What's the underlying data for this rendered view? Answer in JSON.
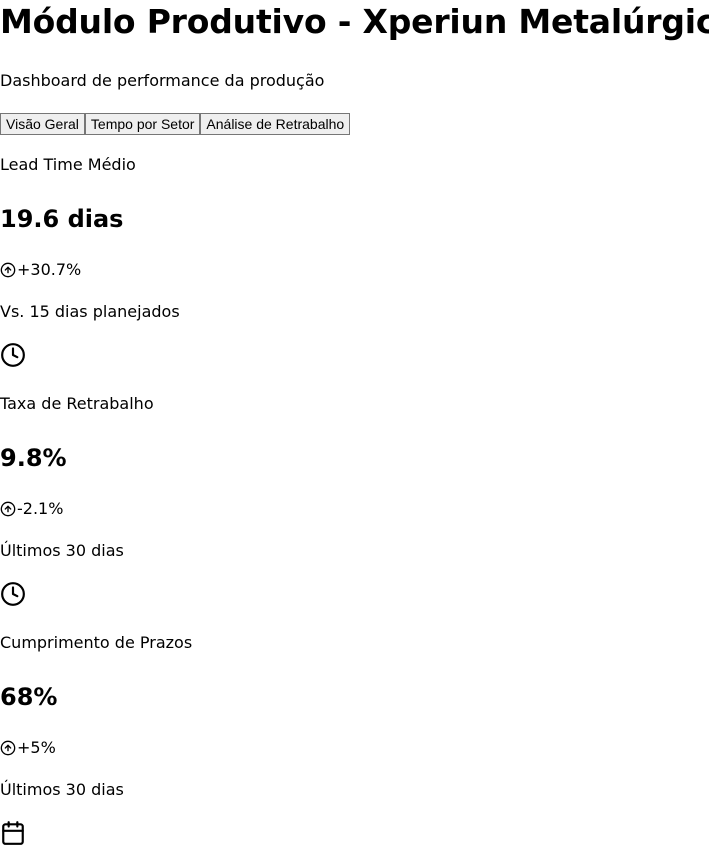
{
  "header": {
    "title": "Módulo Produtivo - Xperiun Metalúrgica",
    "subtitle": "Dashboard de performance da produção"
  },
  "tabs": [
    {
      "label": "Visão Geral"
    },
    {
      "label": "Tempo por Setor"
    },
    {
      "label": "Análise de Retrabalho"
    }
  ],
  "cards": [
    {
      "label": "Lead Time Médio",
      "value": "19.6 dias",
      "change": "+30.7%",
      "change_icon": "arrow-up-circle-icon",
      "note": "Vs. 15 dias planejados",
      "icon": "clock-icon"
    },
    {
      "label": "Taxa de Retrabalho",
      "value": "9.8%",
      "change": "-2.1%",
      "change_icon": "arrow-up-circle-icon",
      "note": "Últimos 30 dias",
      "icon": "clock-icon"
    },
    {
      "label": "Cumprimento de Prazos",
      "value": "68%",
      "change": "+5%",
      "change_icon": "arrow-up-circle-icon",
      "note": "Últimos 30 dias",
      "icon": "calendar-icon"
    }
  ]
}
